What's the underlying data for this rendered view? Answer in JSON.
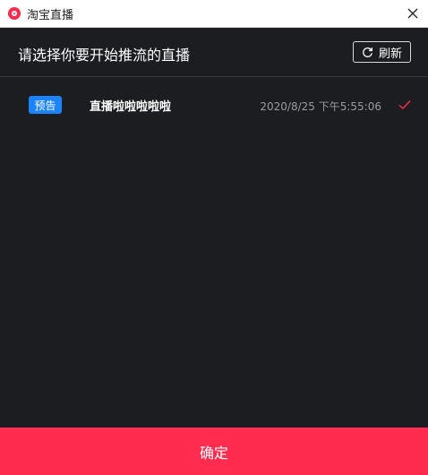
{
  "window": {
    "title": "淘宝直播"
  },
  "header": {
    "title": "请选择你要开始推流的直播",
    "refresh_label": "刷新"
  },
  "list": {
    "items": [
      {
        "badge": "预告",
        "name": "直播啦啦啦啦啦",
        "time": "2020/8/25 下午5:55:06",
        "selected": true
      }
    ]
  },
  "footer": {
    "confirm_label": "确定"
  },
  "colors": {
    "accent": "#ff2c50",
    "badge": "#1c83ff",
    "background": "#1c1d21",
    "check": "#ff2c50"
  },
  "icons": {
    "app": "taobao-live-icon",
    "close": "close-icon",
    "refresh": "refresh-icon",
    "check": "check-icon"
  }
}
